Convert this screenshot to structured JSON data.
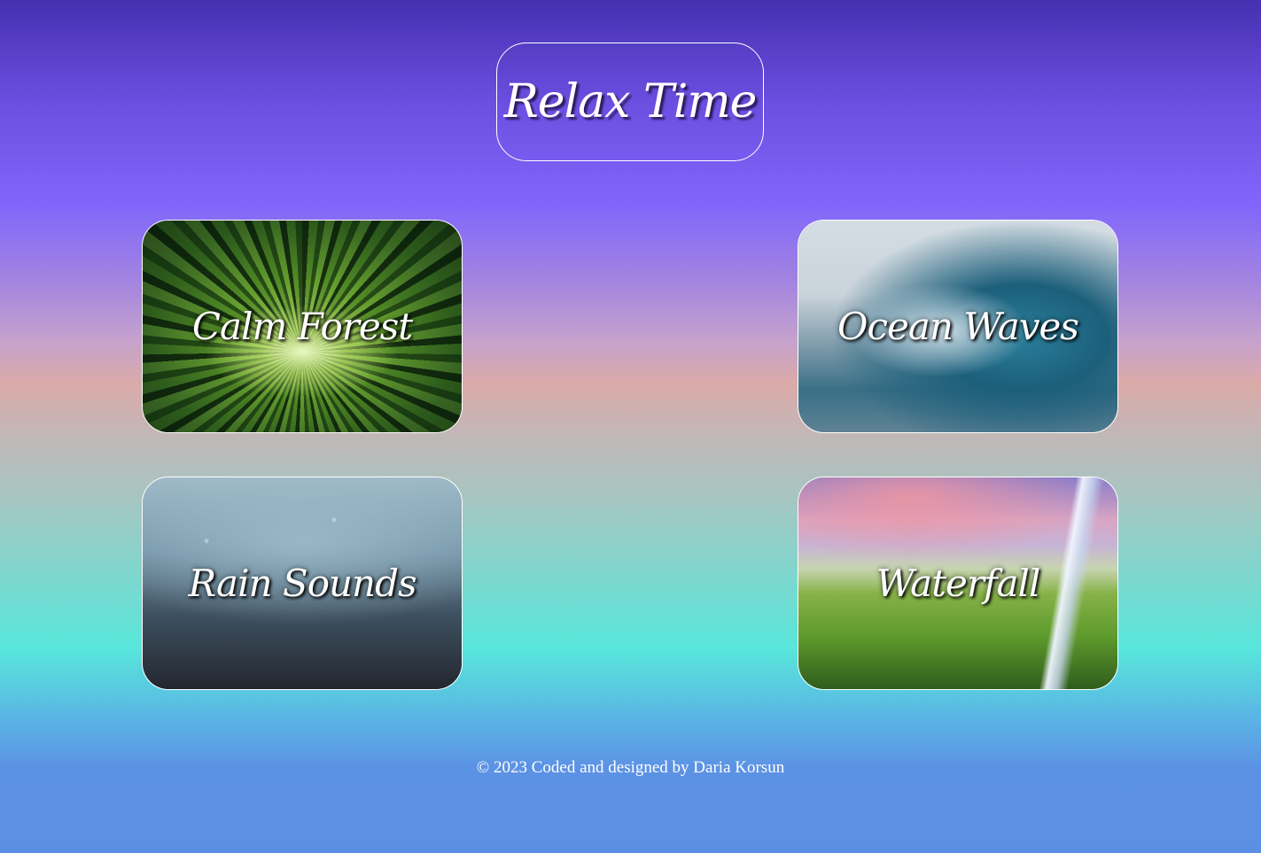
{
  "header": {
    "title": "Relax Time"
  },
  "cards": [
    {
      "label": "Calm Forest"
    },
    {
      "label": "Ocean Waves"
    },
    {
      "label": "Rain Sounds"
    },
    {
      "label": "Waterfall"
    }
  ],
  "footer": {
    "text": "© 2023 Coded and designed by Daria Korsun"
  },
  "colors": {
    "gradient_top": "#4530b0",
    "gradient_mid_purple": "#8066fb",
    "gradient_mid_peach": "#dbaaa8",
    "gradient_mid_cyan": "#58e6db",
    "gradient_bottom": "#5b8fe3",
    "text": "#ffffff"
  }
}
